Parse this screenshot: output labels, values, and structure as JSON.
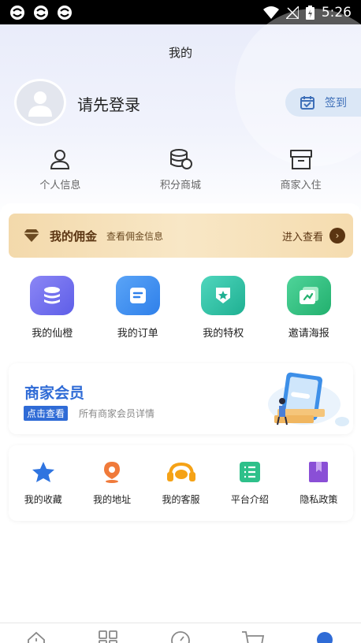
{
  "status_bar": {
    "time": "5:26",
    "icons": [
      "app-notification-icon",
      "app-notification-icon",
      "app-notification-icon",
      "wifi-icon",
      "no-signal-icon",
      "battery-charging-icon"
    ]
  },
  "header": {
    "title": "我的"
  },
  "profile": {
    "login_prompt": "请先登录",
    "signin_label": "签到",
    "avatar_icon": "user-avatar-icon"
  },
  "quick_links": [
    {
      "label": "个人信息",
      "icon": "person-icon"
    },
    {
      "label": "积分商城",
      "icon": "coins-stack-icon"
    },
    {
      "label": "商家入住",
      "icon": "shop-icon"
    }
  ],
  "commission": {
    "title": "我的佣金",
    "subtitle": "查看佣金信息",
    "action": "进入查看",
    "icon": "diamond-icon"
  },
  "features": [
    {
      "label": "我的仙橙",
      "icon": "database-icon",
      "color": "#6b6ef0"
    },
    {
      "label": "我的订单",
      "icon": "document-icon",
      "color": "#3a8ef0"
    },
    {
      "label": "我的特权",
      "icon": "star-shield-icon",
      "color": "#2bbfa4"
    },
    {
      "label": "邀请海报",
      "icon": "poster-icon",
      "color": "#2ebd84"
    }
  ],
  "merchant": {
    "title": "商家会员",
    "badge": "点击查看",
    "description": "所有商家会员详情"
  },
  "tools": [
    {
      "label": "我的收藏",
      "icon": "star-icon",
      "color": "#2f74e0"
    },
    {
      "label": "我的地址",
      "icon": "location-pin-icon",
      "color": "#f07a3a"
    },
    {
      "label": "我的客服",
      "icon": "headset-icon",
      "color": "#f5a216"
    },
    {
      "label": "平台介绍",
      "icon": "list-icon",
      "color": "#2ec08a"
    },
    {
      "label": "隐私政策",
      "icon": "bookmark-icon",
      "color": "#8a4fd6"
    }
  ],
  "tab_bar": {
    "icons": [
      "home-icon",
      "grid-icon",
      "compass-icon",
      "cart-icon",
      "profile-icon"
    ],
    "active_color": "#2f6bd6"
  }
}
